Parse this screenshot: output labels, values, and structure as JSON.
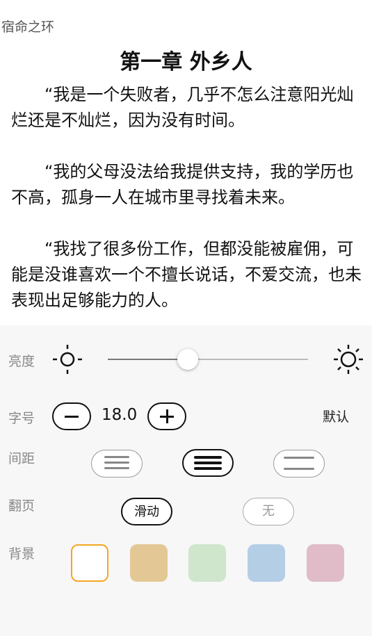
{
  "book": {
    "title": "宿命之环"
  },
  "chapter": {
    "title": "第一章 外乡人"
  },
  "content": {
    "paragraphs": [
      "“我是一个失败者，几乎不怎么注意阳光灿烂还是不灿烂，因为没有时间。",
      "“我的父母没法给我提供支持，我的学历也不高，孤身一人在城市里寻找着未来。",
      "“我找了很多份工作，但都没能被雇佣，可能是没谁喜欢一个不擅长说话，不爱交流，也未表现出足够能力的人。"
    ]
  },
  "settings": {
    "brightness": {
      "label": "亮度",
      "value": 0.4,
      "low_icon": "sun-dim-icon",
      "high_icon": "sun-bright-icon"
    },
    "font_size": {
      "label": "字号",
      "value": "18.0",
      "default_label": "默认"
    },
    "spacing": {
      "label": "间距",
      "options": [
        "loose",
        "medium",
        "tight"
      ],
      "selected": 1
    },
    "page_turn": {
      "label": "翻页",
      "options": [
        "滑动",
        "无"
      ],
      "selected": 0
    },
    "background": {
      "label": "背景",
      "colors": [
        "#ffffff",
        "#e3c896",
        "#cfe6cd",
        "#b4cee6",
        "#e0bcc8"
      ],
      "selected": 0
    },
    "accent_color": "#f5a623"
  }
}
